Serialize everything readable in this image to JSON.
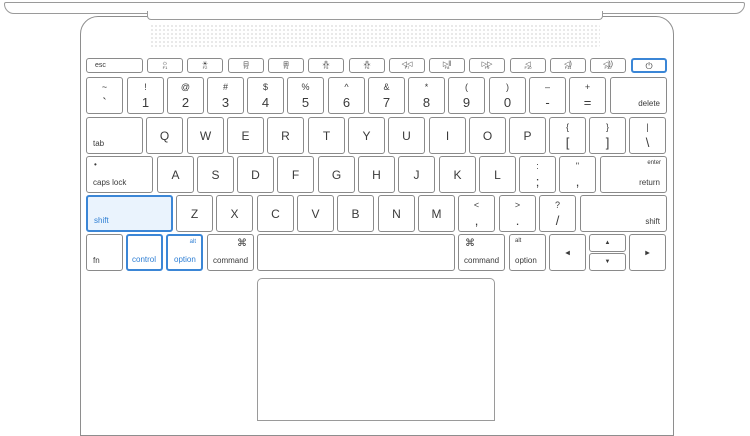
{
  "colors": {
    "outline": "#8a8a8a",
    "highlight": "#3b86d6",
    "highlight_fill": "#eaf3fd"
  },
  "fn_row": [
    {
      "label": "esc",
      "icon": ""
    },
    {
      "label": "F1",
      "icon": "☼"
    },
    {
      "label": "F2",
      "icon": "☀"
    },
    {
      "label": "F3",
      "icon": "⊟"
    },
    {
      "label": "F4",
      "icon": "⊞"
    },
    {
      "label": "F5",
      "icon": "⁂"
    },
    {
      "label": "F6",
      "icon": "⁂"
    },
    {
      "label": "F7",
      "icon": "◁◁"
    },
    {
      "label": "F8",
      "icon": "▷‖"
    },
    {
      "label": "F9",
      "icon": "▷▷"
    },
    {
      "label": "F10",
      "icon": "◁"
    },
    {
      "label": "F11",
      "icon": "◁)"
    },
    {
      "label": "F12",
      "icon": "◁))"
    },
    {
      "label": "",
      "icon": "⏻"
    }
  ],
  "number_row": [
    {
      "top": "~",
      "bottom": "`"
    },
    {
      "top": "!",
      "bottom": "1"
    },
    {
      "top": "@",
      "bottom": "2"
    },
    {
      "top": "#",
      "bottom": "3"
    },
    {
      "top": "$",
      "bottom": "4"
    },
    {
      "top": "%",
      "bottom": "5"
    },
    {
      "top": "^",
      "bottom": "6"
    },
    {
      "top": "&",
      "bottom": "7"
    },
    {
      "top": "*",
      "bottom": "8"
    },
    {
      "top": "(",
      "bottom": "9"
    },
    {
      "top": ")",
      "bottom": "0"
    },
    {
      "top": "–",
      "bottom": "-"
    },
    {
      "top": "+",
      "bottom": "="
    }
  ],
  "delete_label": "delete",
  "tab_label": "tab",
  "qwerty_row": [
    "Q",
    "W",
    "E",
    "R",
    "T",
    "Y",
    "U",
    "I",
    "O",
    "P"
  ],
  "qwerty_punct": [
    {
      "top": "{",
      "bottom": "["
    },
    {
      "top": "}",
      "bottom": "]"
    },
    {
      "top": "|",
      "bottom": "\\"
    }
  ],
  "caps_label": "caps lock",
  "caps_dot": "•",
  "home_row": [
    "A",
    "S",
    "D",
    "F",
    "G",
    "H",
    "J",
    "K",
    "L"
  ],
  "home_punct": [
    {
      "top": ":",
      "bottom": ";"
    },
    {
      "top": "\"",
      "bottom": ","
    }
  ],
  "enter_label": "enter",
  "return_label": "return",
  "shift_label": "shift",
  "bottom_letters": [
    "Z",
    "X",
    "C",
    "V",
    "B",
    "N",
    "M"
  ],
  "bottom_punct": [
    {
      "top": "<",
      "bottom": ","
    },
    {
      "top": ">",
      "bottom": "."
    },
    {
      "top": "?",
      "bottom": "/"
    }
  ],
  "fn_label": "fn",
  "control_label": "control",
  "alt_label": "alt",
  "option_label": "option",
  "cmd_symbol": "⌘",
  "command_label": "command",
  "arrows": {
    "left": "◀",
    "up": "▲",
    "down": "▼",
    "right": "▶"
  }
}
